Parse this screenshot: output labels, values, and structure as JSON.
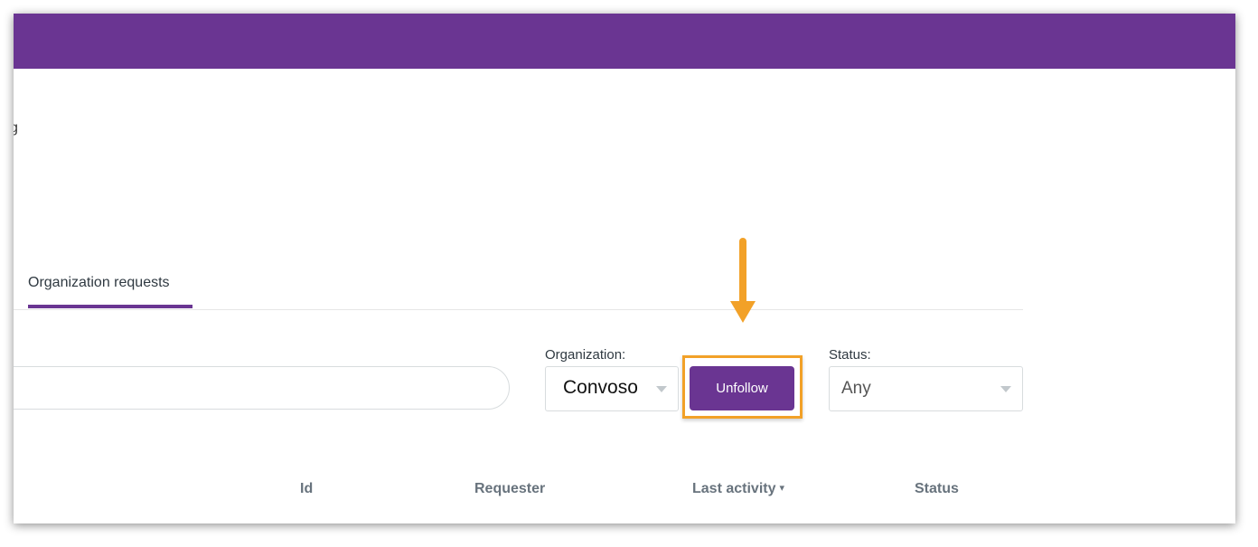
{
  "colors": {
    "brand": "#6a3592",
    "highlight": "#f2a128",
    "divider": "#e6e6e6"
  },
  "page": {
    "cut_text": "g"
  },
  "tabs": [
    {
      "label": "Organization requests",
      "active": true
    }
  ],
  "filters": {
    "search": {
      "value": "",
      "placeholder": ""
    },
    "organization": {
      "label": "Organization:",
      "value": "Convoso"
    },
    "unfollow_label": "Unfollow",
    "status": {
      "label": "Status:",
      "value": "Any"
    }
  },
  "table": {
    "columns": [
      "Id",
      "Requester",
      "Last activity",
      "Status"
    ],
    "sort_column": "Last activity",
    "sort_icon": "▾"
  },
  "annotation": {
    "type": "callout-arrow",
    "icon": "arrow-down-icon"
  }
}
